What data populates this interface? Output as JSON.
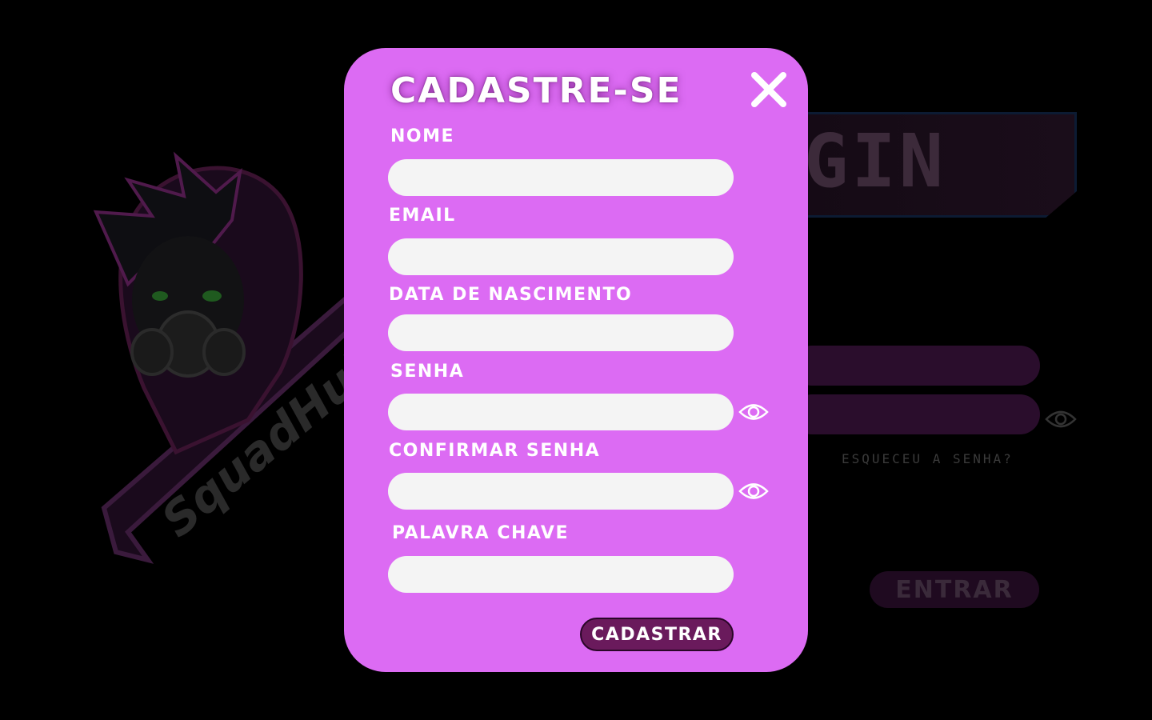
{
  "background": {
    "logo_text": "SquadHub",
    "login_title": "GIN",
    "forgot_password": "ESQUECEU A SENHA?",
    "enter_button": "ENTRAR"
  },
  "modal": {
    "title": "CADASTRE-SE",
    "close_icon": "close-icon",
    "fields": [
      {
        "label": "NOME",
        "value": ""
      },
      {
        "label": "EMAIL",
        "value": ""
      },
      {
        "label": "DATA DE NASCIMENTO",
        "value": ""
      },
      {
        "label": "SENHA",
        "value": "",
        "toggle_icon": "eye-icon"
      },
      {
        "label": "CONFIRMAR SENHA",
        "value": "",
        "toggle_icon": "eye-icon"
      },
      {
        "label": "PALAVRA CHAVE",
        "value": ""
      }
    ],
    "submit_label": "CADASTRAR"
  },
  "colors": {
    "modal_bg": "#dc6bf3",
    "submit_bg": "#6a1a5c",
    "input_bg": "#f4f4f4",
    "page_bg": "#000000"
  }
}
